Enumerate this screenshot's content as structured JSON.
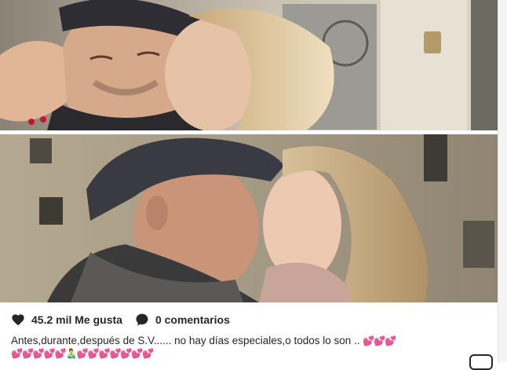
{
  "post": {
    "likes_label": "45.2 mil Me gusta",
    "comments_label": "0 comentarios",
    "caption_text": "Antes,durante,después de S.V...... no hay días especiales,o todos lo son ..",
    "caption_hearts": "💕💕💕",
    "caption_line2": "💕💕💕💕💕👨‍🍼💕💕💕💕💕💕💕",
    "icons": {
      "like": "heart-icon",
      "comment": "comment-bubble-icon",
      "more": "more-options-icon"
    },
    "colors": {
      "text": "#262626",
      "accent_pink": "#f06292"
    }
  }
}
